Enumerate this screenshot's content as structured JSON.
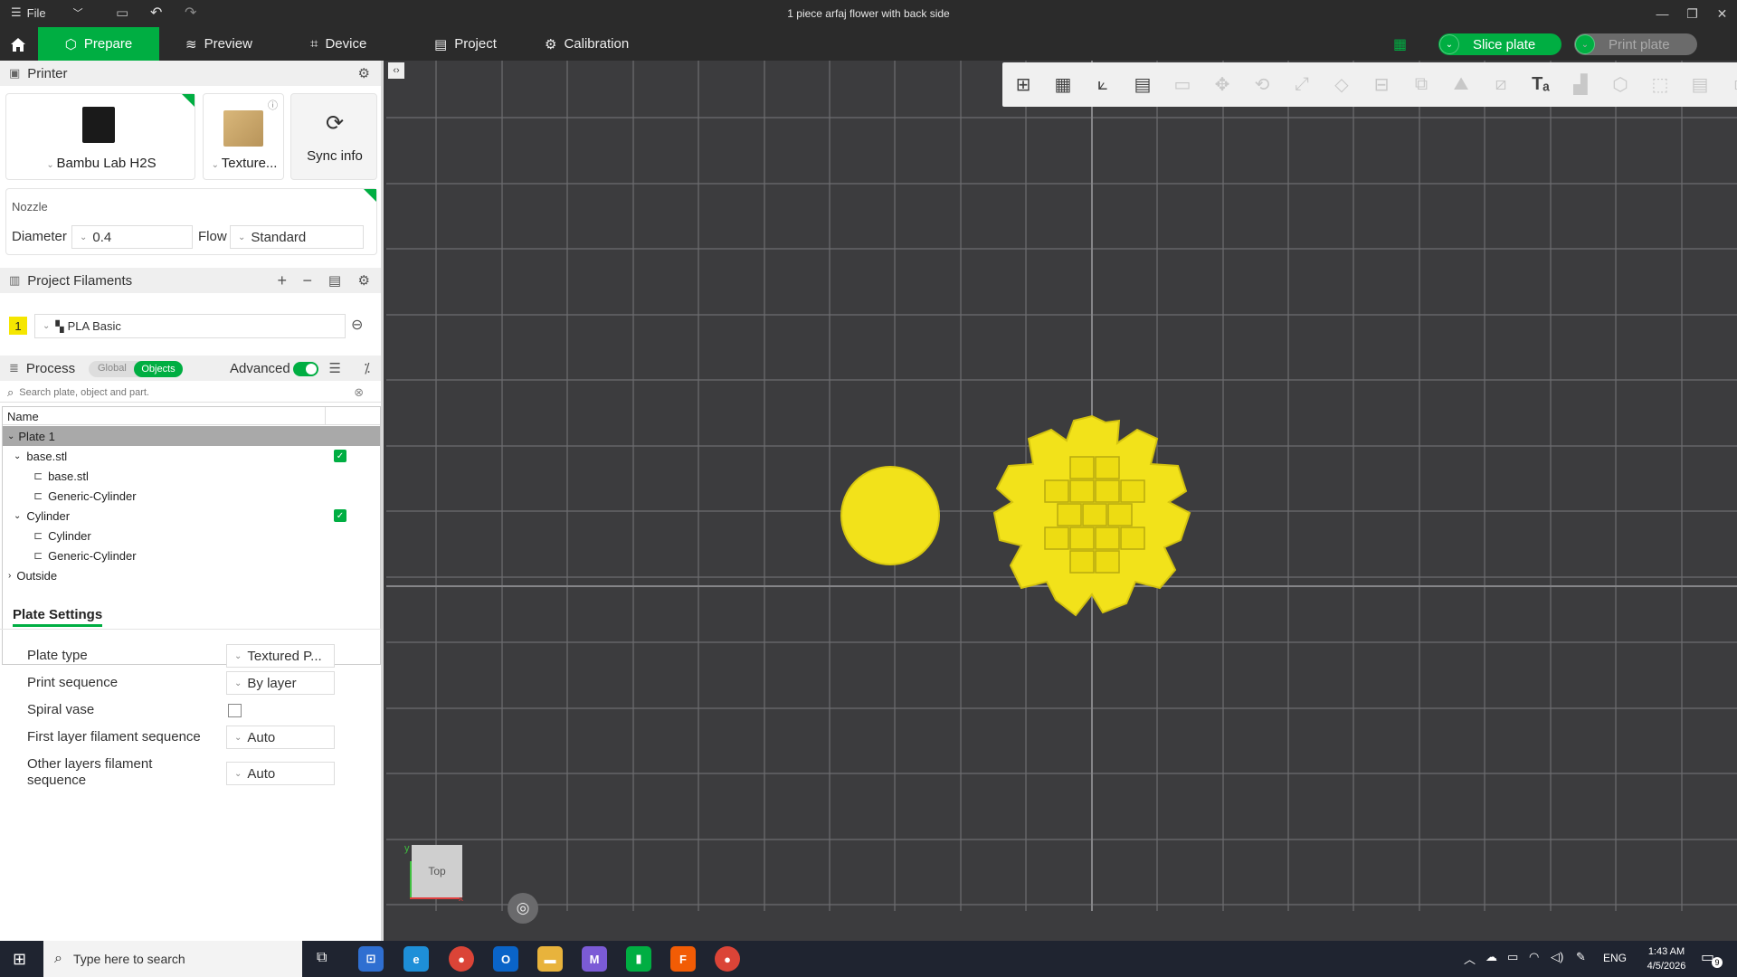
{
  "titlebar": {
    "file_label": "File",
    "title": "1 piece arfaj flower with back side"
  },
  "tabs": {
    "prepare": "Prepare",
    "preview": "Preview",
    "device": "Device",
    "project": "Project",
    "calibration": "Calibration"
  },
  "actions": {
    "slice": "Slice plate",
    "print": "Print plate"
  },
  "printer": {
    "header": "Printer",
    "model": "Bambu Lab H2S",
    "plate": "Texture...",
    "sync": "Sync info",
    "nozzle_label": "Nozzle",
    "diameter_label": "Diameter",
    "diameter_value": "0.4",
    "flow_label": "Flow",
    "flow_value": "Standard"
  },
  "filaments": {
    "header": "Project Filaments",
    "items": [
      {
        "index": "1",
        "name": "PLA Basic",
        "color": "#f5e600"
      }
    ]
  },
  "process": {
    "header": "Process",
    "global": "Global",
    "objects": "Objects",
    "advanced": "Advanced"
  },
  "search": {
    "placeholder": "Search plate, object and part."
  },
  "tree": {
    "column": "Name",
    "plate": "Plate 1",
    "rows": [
      "base.stl",
      "base.stl",
      "Generic-Cylinder",
      "Cylinder",
      "Cylinder",
      "Generic-Cylinder",
      "Outside"
    ]
  },
  "plate_settings": {
    "title": "Plate Settings",
    "plate_type_label": "Plate type",
    "plate_type_value": "Textured P...",
    "print_seq_label": "Print sequence",
    "print_seq_value": "By layer",
    "spiral_label": "Spiral vase",
    "first_layer_label": "First layer filament sequence",
    "first_layer_value": "Auto",
    "other_layers_label": "Other layers filament sequence",
    "other_layers_value": "Auto"
  },
  "viewport": {
    "view_cube": "Top",
    "axis_x": "x",
    "axis_y": "y",
    "model_color": "#f2e21a"
  },
  "taskbar": {
    "search_placeholder": "Type here to search",
    "lang": "ENG",
    "time": "1:43 AM",
    "date": "4/5/2026",
    "notif_count": "9"
  },
  "colors": {
    "accent": "#00ae42"
  }
}
